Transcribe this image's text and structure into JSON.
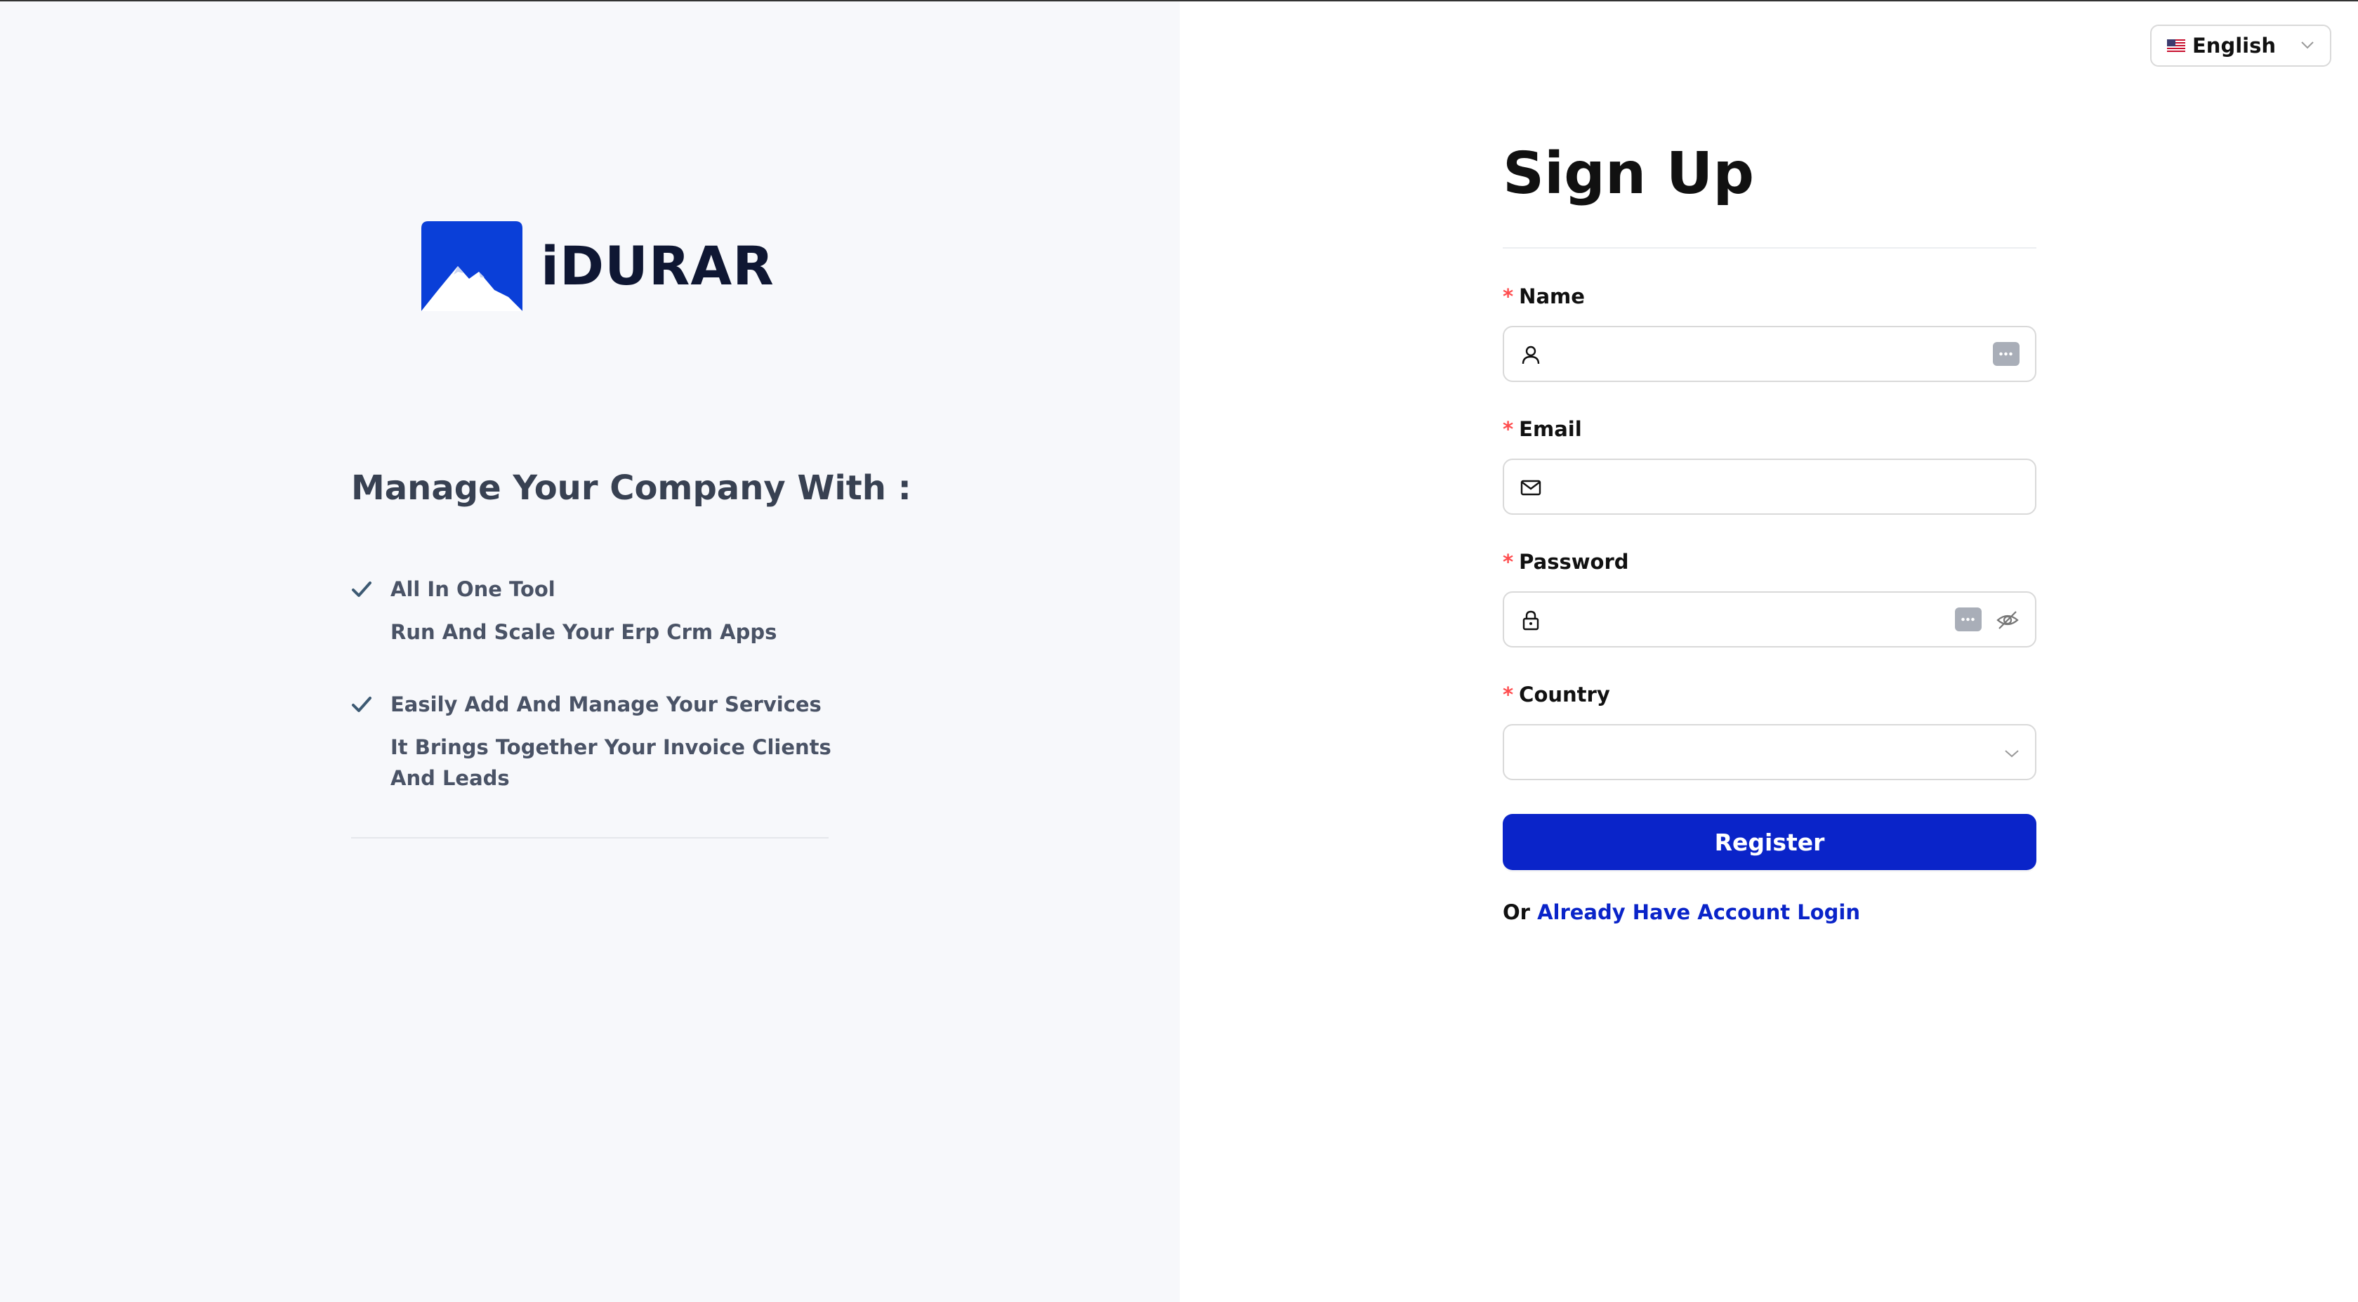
{
  "brand": {
    "name": "iDURAR",
    "logo_icon": "mountain-logo-icon"
  },
  "marketing": {
    "tagline": "Manage Your Company With :",
    "features": [
      {
        "title": "All In One Tool",
        "description": "Run And Scale Your Erp Crm Apps"
      },
      {
        "title": "Easily Add And Manage Your Services",
        "description": "It Brings Together Your Invoice Clients And Leads"
      }
    ]
  },
  "language": {
    "selected": "English",
    "flag_icon": "us-flag-icon"
  },
  "form": {
    "title": "Sign Up",
    "fields": {
      "name": {
        "label": "Name",
        "value": "",
        "icon": "user-icon"
      },
      "email": {
        "label": "Email",
        "value": "",
        "icon": "mail-icon"
      },
      "password": {
        "label": "Password",
        "value": "",
        "icon": "lock-icon"
      },
      "country": {
        "label": "Country",
        "value": ""
      }
    },
    "required_mark": "*",
    "register_label": "Register",
    "alt_prefix": "Or",
    "login_link": "Already Have Account Login"
  },
  "colors": {
    "primary": "#0a24c9",
    "required": "#ff4d4f",
    "left_bg": "#f7f8fb"
  }
}
